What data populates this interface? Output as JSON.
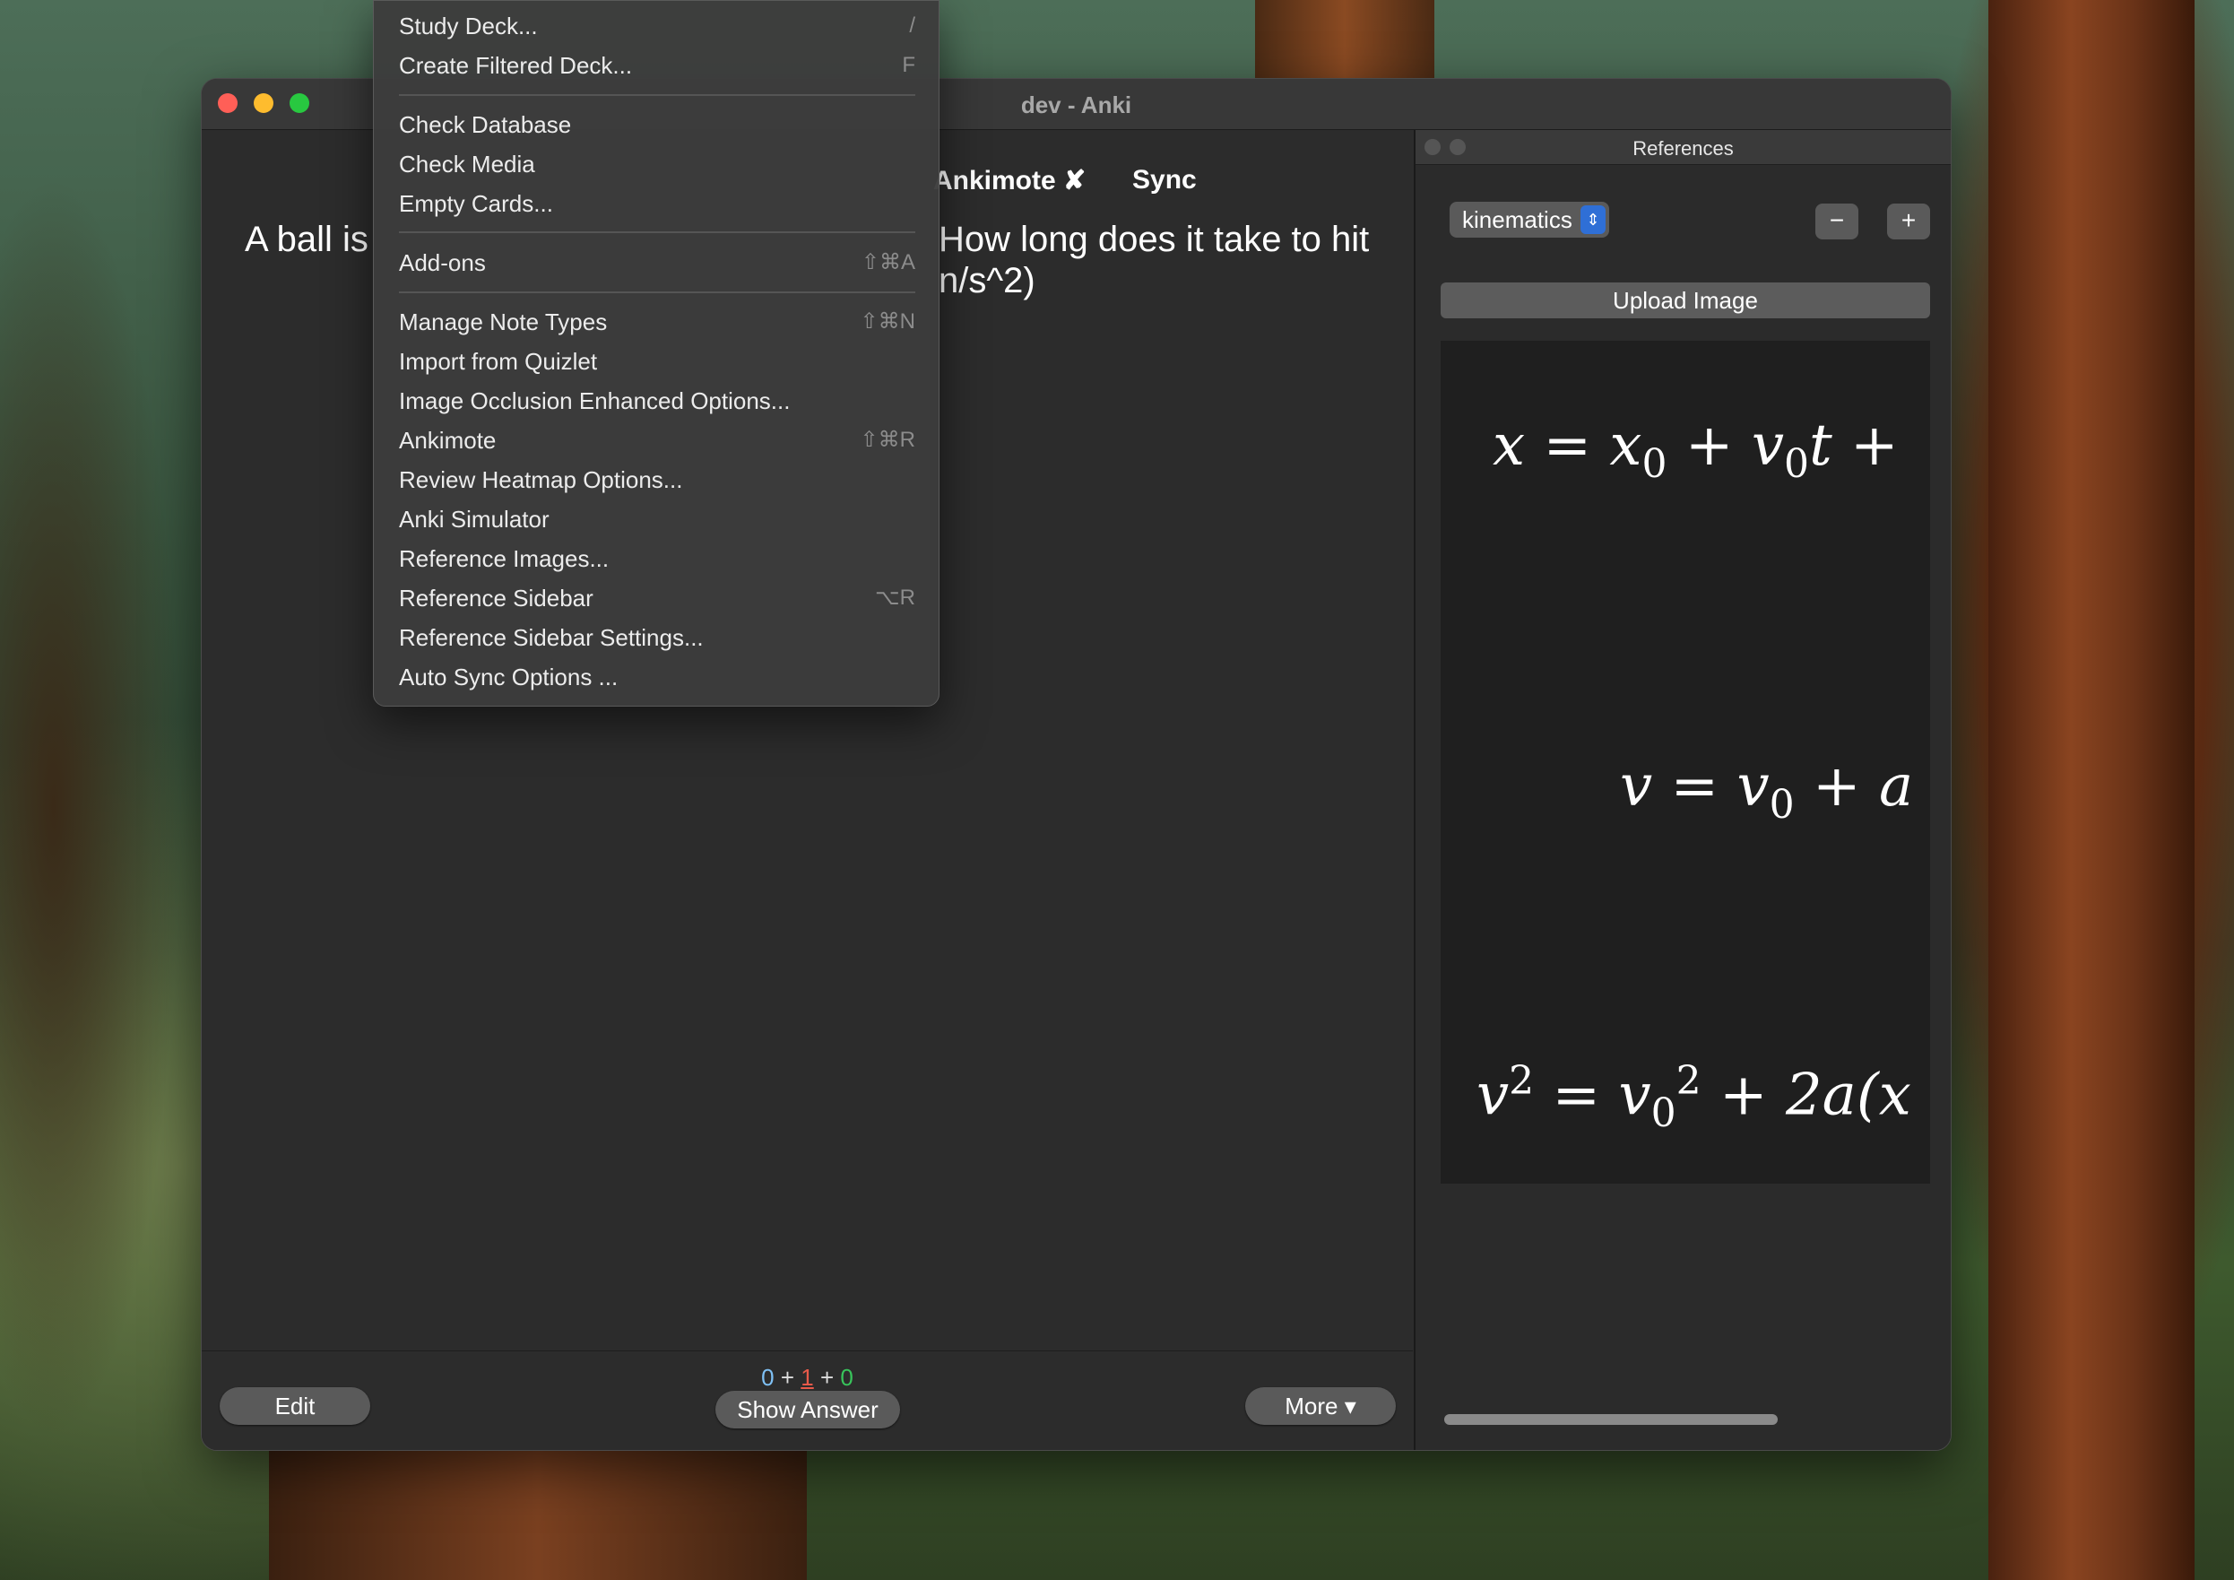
{
  "window": {
    "title": "dev - Anki"
  },
  "toolbar": {
    "ankimote_label": "Ankimote ✘",
    "sync_label": "Sync"
  },
  "card": {
    "question_left": "A ball is",
    "question_right": "How long does it take to hit",
    "question_line2": "n/s^2)"
  },
  "bottom": {
    "edit_label": "Edit",
    "show_answer_label": "Show Answer",
    "more_label": "More ▾",
    "counts": {
      "new": "0",
      "plus1": "+",
      "learn": "1",
      "plus2": "+",
      "review": "0"
    }
  },
  "sidebar": {
    "title": "References",
    "select_value": "kinematics",
    "minus_label": "−",
    "plus_label": "+",
    "upload_label": "Upload Image"
  },
  "menu": {
    "items": [
      {
        "label": "Study Deck...",
        "shortcut": "/"
      },
      {
        "label": "Create Filtered Deck...",
        "shortcut": "F"
      },
      {
        "label": "Check Database",
        "shortcut": ""
      },
      {
        "label": "Check Media",
        "shortcut": ""
      },
      {
        "label": "Empty Cards...",
        "shortcut": ""
      },
      {
        "label": "Add-ons",
        "shortcut": "⇧⌘A"
      },
      {
        "label": "Manage Note Types",
        "shortcut": "⇧⌘N"
      },
      {
        "label": "Import from Quizlet",
        "shortcut": ""
      },
      {
        "label": "Image Occlusion Enhanced Options...",
        "shortcut": ""
      },
      {
        "label": "Ankimote",
        "shortcut": "⇧⌘R"
      },
      {
        "label": "Review Heatmap Options...",
        "shortcut": ""
      },
      {
        "label": "Anki Simulator",
        "shortcut": ""
      },
      {
        "label": "Reference Images...",
        "shortcut": ""
      },
      {
        "label": "Reference Sidebar",
        "shortcut": "⌥R"
      },
      {
        "label": "Reference Sidebar Settings...",
        "shortcut": ""
      },
      {
        "label": "Auto Sync Options ...",
        "shortcut": ""
      }
    ]
  },
  "colors": {
    "accent": "#2f6fd6",
    "close": "#ff5f57",
    "minimize": "#febc2e",
    "maximize": "#28c840"
  }
}
